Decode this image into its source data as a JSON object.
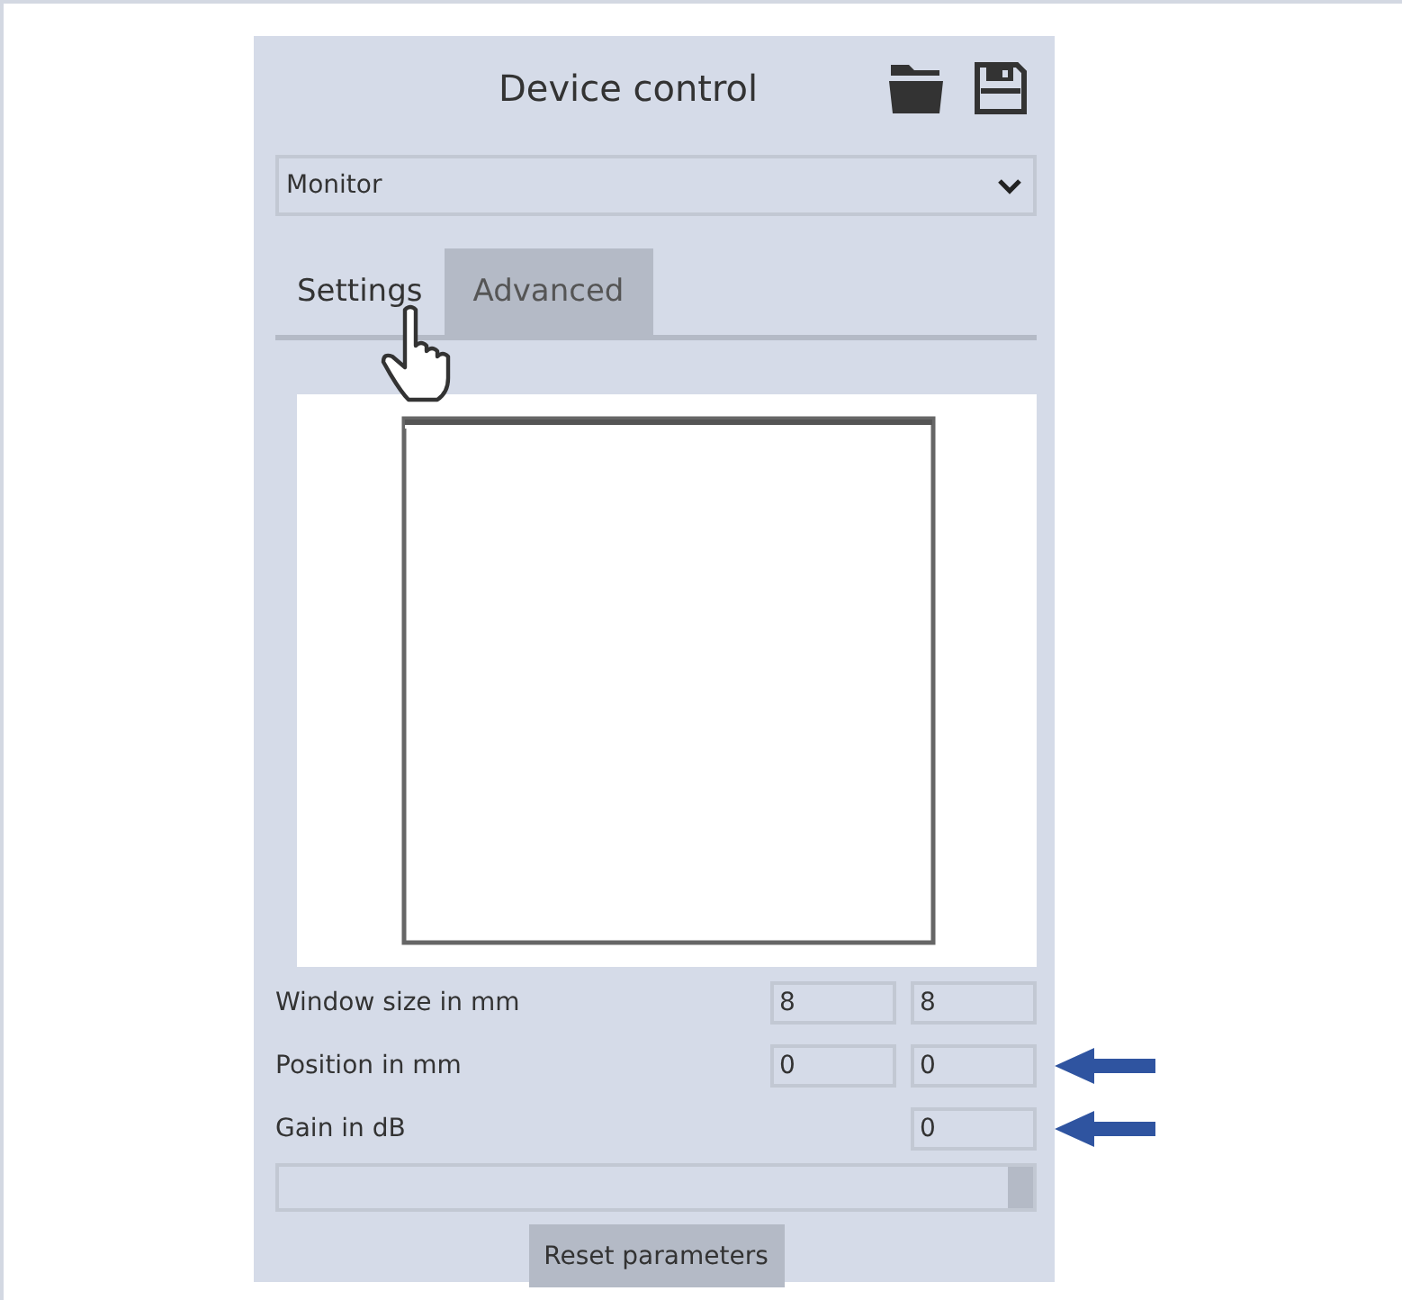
{
  "panel": {
    "title": "Device control"
  },
  "device_select": {
    "value": "Monitor"
  },
  "tabs": [
    {
      "label": "Settings",
      "selected": true
    },
    {
      "label": "Advanced",
      "selected": false
    }
  ],
  "parameters": [
    {
      "label": "Window size in mm",
      "values": [
        "8",
        "8"
      ],
      "annotated": false
    },
    {
      "label": "Position in mm",
      "values": [
        "0",
        "0"
      ],
      "annotated": true
    },
    {
      "label": "Gain in dB",
      "values": [
        "0"
      ],
      "annotated": true
    }
  ],
  "slider": {
    "level": 1
  },
  "reset_button": {
    "label": "Reset parameters"
  }
}
